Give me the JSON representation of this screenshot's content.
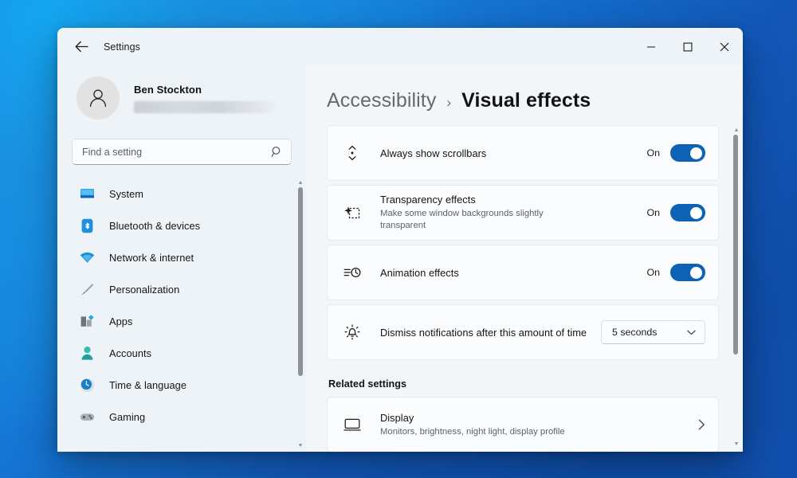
{
  "window": {
    "title": "Settings",
    "back_icon": "arrow-left-icon",
    "controls": {
      "minimize": "minimize-icon",
      "maximize": "maximize-icon",
      "close": "close-icon"
    }
  },
  "account": {
    "name": "Ben Stockton",
    "email_redacted": "",
    "avatar_icon": "person-icon"
  },
  "search": {
    "placeholder": "Find a setting",
    "value": "",
    "icon": "search-icon"
  },
  "sidebar": {
    "items": [
      {
        "label": "System",
        "icon": "monitor-icon"
      },
      {
        "label": "Bluetooth & devices",
        "icon": "bluetooth-icon"
      },
      {
        "label": "Network & internet",
        "icon": "wifi-icon"
      },
      {
        "label": "Personalization",
        "icon": "brush-icon"
      },
      {
        "label": "Apps",
        "icon": "apps-icon"
      },
      {
        "label": "Accounts",
        "icon": "account-icon"
      },
      {
        "label": "Time & language",
        "icon": "clock-icon"
      },
      {
        "label": "Gaming",
        "icon": "gamepad-icon"
      }
    ],
    "scrollbar": {
      "up_arrow": "chevron-up-icon",
      "down_arrow": "chevron-down-icon"
    }
  },
  "breadcrumb": {
    "parent": "Accessibility",
    "separator": "›",
    "current": "Visual effects"
  },
  "settings": [
    {
      "title": "Always show scrollbars",
      "subtitle": "",
      "icon": "scrollbar-icon",
      "control": "toggle",
      "state_label": "On",
      "state": "on"
    },
    {
      "title": "Transparency effects",
      "subtitle": "Make some window backgrounds slightly transparent",
      "icon": "transparency-icon",
      "control": "toggle",
      "state_label": "On",
      "state": "on"
    },
    {
      "title": "Animation effects",
      "subtitle": "",
      "icon": "animation-icon",
      "control": "toggle",
      "state_label": "On",
      "state": "on"
    },
    {
      "title": "Dismiss notifications after this amount of time",
      "subtitle": "",
      "icon": "notification-bell-icon",
      "control": "dropdown",
      "value": "5 seconds",
      "chevron": "chevron-down-icon"
    }
  ],
  "related": {
    "heading": "Related settings",
    "items": [
      {
        "title": "Display",
        "subtitle": "Monitors, brightness, night light, display profile",
        "icon": "display-icon",
        "chevron": "chevron-right-icon"
      }
    ]
  },
  "colors": {
    "accent": "#0d62b5",
    "window_bg": "#f3f6f9",
    "sidebar_bg": "#eef3f7",
    "card_bg": "#fbfcfd",
    "desktop_gradient_start": "#0f9ded",
    "desktop_gradient_end": "#0e4da8"
  }
}
